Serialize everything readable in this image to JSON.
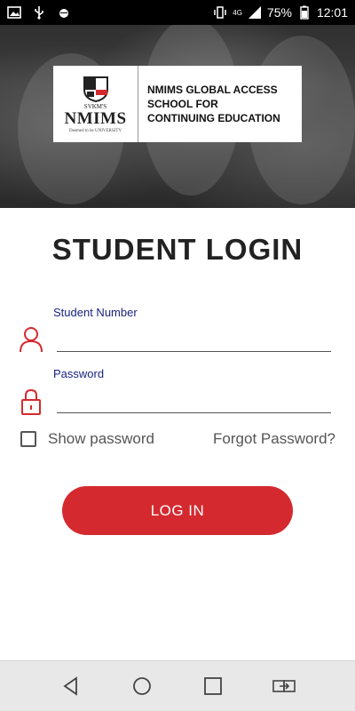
{
  "status_bar": {
    "battery": "75%",
    "time": "12:01",
    "network": "4G",
    "left_icons": [
      "image-icon",
      "usb-icon",
      "android-debug-icon"
    ],
    "right_icons": [
      "vibrate-icon",
      "signal-icon",
      "battery-icon"
    ]
  },
  "header": {
    "logo": {
      "prefix": "SVKM'S",
      "name": "NMIMS",
      "tagline": "Deemed to be UNIVERSITY",
      "school_line1": "NMIMS GLOBAL ACCESS",
      "school_line2": "SCHOOL FOR",
      "school_line3": "CONTINUING EDUCATION"
    }
  },
  "login": {
    "title": "STUDENT LOGIN",
    "student_number_label": "Student Number",
    "student_number_value": "",
    "password_label": "Password",
    "password_value": "",
    "show_password_label": "Show password",
    "show_password_checked": false,
    "forgot_password": "Forgot Password?",
    "submit": "LOG IN"
  },
  "colors": {
    "accent": "#d42a2f",
    "label": "#1a237e"
  },
  "nav_bar": {
    "buttons": [
      "back-icon",
      "home-icon",
      "recents-icon",
      "switch-app-icon"
    ]
  }
}
